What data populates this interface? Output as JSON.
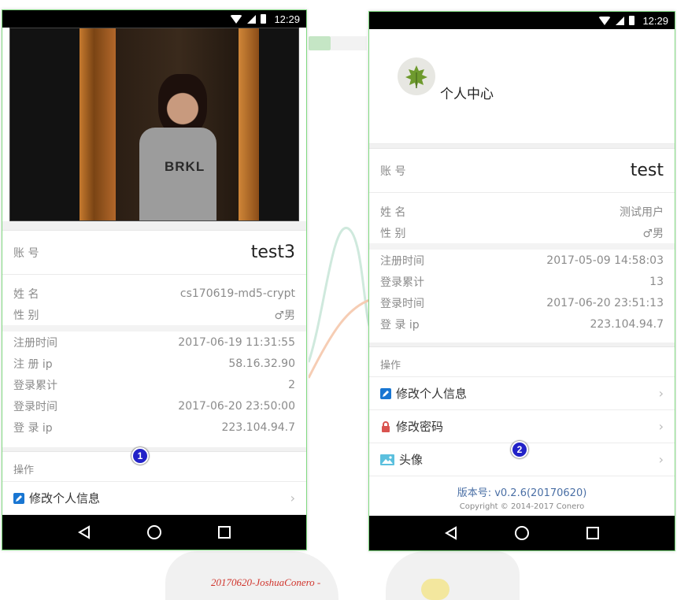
{
  "status_bar": {
    "time": "12:29"
  },
  "left_phone": {
    "account_label": "账  号",
    "account_value": "test3",
    "info": [
      {
        "label": "姓  名",
        "value": "cs170619-md5-crypt"
      },
      {
        "label": "性  别",
        "value": "♂男"
      }
    ],
    "details": [
      {
        "label": "注册时间",
        "value": "2017-06-19 11:31:55"
      },
      {
        "label": "注 册 ip",
        "value": "58.16.32.90"
      },
      {
        "label": "登录累计",
        "value": "2"
      },
      {
        "label": "登录时间",
        "value": "2017-06-20 23:50:00"
      },
      {
        "label": "登 录 ip",
        "value": "223.104.94.7"
      }
    ],
    "section_title": "操作",
    "menu": [
      {
        "label": "修改个人信息",
        "icon": "edit-icon",
        "color": "#1976d2"
      }
    ],
    "photo_text": "BRKL"
  },
  "right_phone": {
    "header_title": "个人中心",
    "account_label": "账  号",
    "account_value": "test",
    "info": [
      {
        "label": "姓  名",
        "value": "测试用户"
      },
      {
        "label": "性  别",
        "value": "♂男"
      }
    ],
    "details": [
      {
        "label": "注册时间",
        "value": "2017-05-09 14:58:03"
      },
      {
        "label": "登录累计",
        "value": "13"
      },
      {
        "label": "登录时间",
        "value": "2017-06-20 23:51:13"
      },
      {
        "label": "登 录 ip",
        "value": "223.104.94.7"
      }
    ],
    "section_title": "操作",
    "menu": [
      {
        "label": "修改个人信息",
        "icon": "edit-icon",
        "color": "#1976d2"
      },
      {
        "label": "修改密码",
        "icon": "lock-icon",
        "color": "#d9534f"
      },
      {
        "label": "头像",
        "icon": "image-icon",
        "color": "#5bc0de"
      }
    ],
    "version": "版本号: v0.2.6(20170620)",
    "copyright": "Copyright © 2014-2017 Conero"
  },
  "badges": {
    "one": "1",
    "two": "2"
  },
  "caption": "20170620-JoshuaConero -"
}
